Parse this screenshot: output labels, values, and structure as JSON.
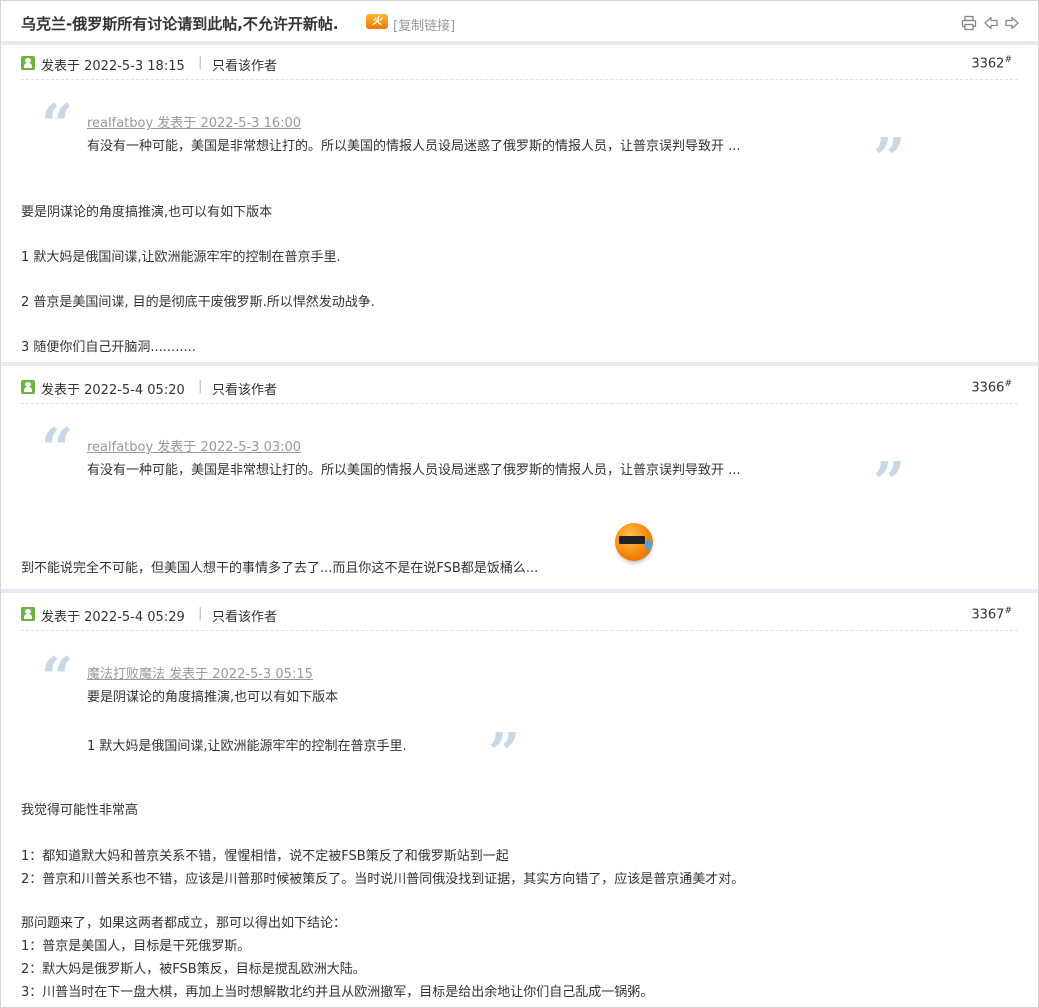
{
  "header": {
    "title": "乌克兰-俄罗斯所有讨论请到此帖,不允许开新帖.",
    "hot_badge": "火",
    "copy_link": "[复制链接]",
    "icons": [
      "print-icon",
      "prev-thread-icon",
      "next-thread-icon"
    ]
  },
  "posts": [
    {
      "date": "发表于 2022-5-3 18:15",
      "pipe": "|",
      "author_only": "只看该作者",
      "floor": "3362",
      "floor_mark": "#",
      "quote": {
        "author": "realfatboy 发表于 2022-5-3 16:00",
        "lines": [
          "有没有一种可能，美国是非常想让打的。所以美国的情报人员设局迷惑了俄罗斯的情报人员，让普京误判导致开 ..."
        ]
      },
      "lines": [
        "要是阴谋论的角度搞推演,也可以有如下版本",
        "1 默大妈是俄国间谍,让欧洲能源牢牢的控制在普京手里.",
        "2 普京是美国间谍, 目的是彻底干废俄罗斯.所以悍然发动战争.",
        "3 随便你们自己开脑洞..........."
      ]
    },
    {
      "date": "发表于 2022-5-4 05:20",
      "pipe": "|",
      "author_only": "只看该作者",
      "floor": "3366",
      "floor_mark": "#",
      "quote": {
        "author": "realfatboy 发表于 2022-5-3 03:00",
        "lines": [
          "有没有一种可能，美国是非常想让打的。所以美国的情报人员设局迷惑了俄罗斯的情报人员，让普京误判导致开 ..."
        ]
      },
      "lines": [
        "到不能说完全不可能，但美国人想干的事情多了去了...而且你这不是在说FSB都是饭桶么..."
      ],
      "emoji": "cool-sweat-emoji"
    },
    {
      "date": "发表于 2022-5-4 05:29",
      "pipe": "|",
      "author_only": "只看该作者",
      "floor": "3367",
      "floor_mark": "#",
      "quote": {
        "author": "魔法打败魔法 发表于 2022-5-3 05:15",
        "lines": [
          "要是阴谋论的角度搞推演,也可以有如下版本",
          "1 默大妈是俄国间谍,让欧洲能源牢牢的控制在普京手里."
        ]
      },
      "lines": [
        "我觉得可能性非常高",
        "1：都知道默大妈和普京关系不错，惺惺相惜，说不定被FSB策反了和俄罗斯站到一起",
        "2：普京和川普关系也不错，应该是川普那时候被策反了。当时说川普同俄没找到证据，其实方向错了，应该是普京通美才对。",
        "那问题来了，如果这两者都成立，那可以得出如下结论：",
        "1：普京是美国人，目标是干死俄罗斯。",
        "2：默大妈是俄罗斯人，被FSB策反，目标是搅乱欧洲大陆。",
        "3：川普当时在下一盘大棋，再加上当时想解散北约并且从欧洲撤军，目标是给出余地让你们自己乱成一锅粥。"
      ]
    }
  ]
}
